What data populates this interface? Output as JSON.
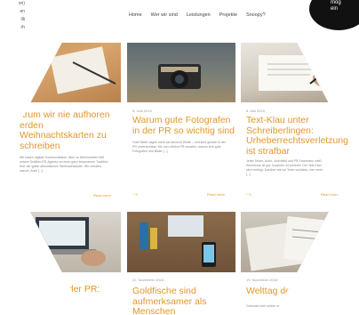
{
  "nav": {
    "items": [
      "Home",
      "Wer wir sind",
      "Leistungen",
      "Projekte",
      "Snoopy?"
    ]
  },
  "overlays": {
    "top_left_lines": [
      "on)",
      "en",
      "",
      "illi",
      "rh"
    ],
    "top_right_lines": [
      "mög",
      "ein"
    ]
  },
  "cards": [
    {
      "date": "",
      "title": "arum wir nie aufhoren erden Weihnachtskarten zu schreiben",
      "body": "Wir haben digitale Kommunikation. Aber zu Weihnachten hält unsere Grafiker-PR-Agentur an einer ganz besonderen Tradition fest: der guten altmodischen Weihnachtskarte. Wir verraten, warum. Auch [...]",
      "likes": "",
      "read_more": "Read more"
    },
    {
      "date": "5. Juni 2019",
      "title": "Warum gute Fotografen in der PR so wichtig sind",
      "body": "Gute Bilder sagen mehr als tausend Worte – und sind gerade in der PR unverzichtbar. Wir von Lifeline PR verraten, warum sich gute Fotografen und Bilder [...]",
      "likes": "0",
      "read_more": "Read more"
    },
    {
      "date": "8. Mai 2019",
      "title": "Text-Klau unter Schreiberlingen: Urheberrechtsverletzung ist strafbar",
      "body": "Jeder Texter, Autor, Journalist und PR-Fachmann weiß: Recherche ist gut, Kopieren ist schlecht. Der Text-Klau wird verfolgt. Darüber wie wir Texte schützen, hier mehr [...]",
      "likes": "0",
      "read_more": "Read more"
    },
    {
      "date": "",
      "title": "n der PR:",
      "body": "",
      "likes": "",
      "read_more": ""
    },
    {
      "date": "22. November 2018",
      "title": "Goldfische sind aufmerksamer als Menschen",
      "body": "",
      "likes": "",
      "read_more": ""
    },
    {
      "date": "19. November 2018",
      "title": "Welttag der Z",
      "body": "Gedruckt oder online: ein Anlass, um über [...]",
      "likes": "",
      "read_more": ""
    }
  ],
  "colors": {
    "accent": "#e3962a",
    "nav_text": "#444444"
  }
}
